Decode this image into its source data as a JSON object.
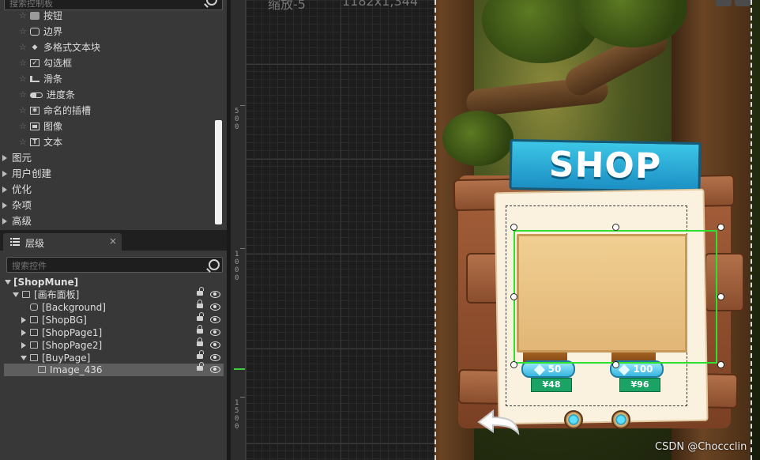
{
  "palette": {
    "search_placeholder": "搜索控制板",
    "items": [
      {
        "label": "按钮",
        "icon": "button-icon"
      },
      {
        "label": "边界",
        "icon": "border-icon"
      },
      {
        "label": "多格式文本块",
        "icon": "rich-text-icon"
      },
      {
        "label": "勾选框",
        "icon": "checkbox-icon"
      },
      {
        "label": "滑条",
        "icon": "slider-icon"
      },
      {
        "label": "进度条",
        "icon": "progress-bar-icon"
      },
      {
        "label": "命名的插槽",
        "icon": "named-slot-icon"
      },
      {
        "label": "图像",
        "icon": "image-icon"
      },
      {
        "label": "文本",
        "icon": "text-icon"
      }
    ],
    "categories": [
      "图元",
      "用户创建",
      "优化",
      "杂项",
      "高级"
    ]
  },
  "hierarchy": {
    "tab_label": "层级",
    "search_placeholder": "搜索控件",
    "rows": [
      {
        "label": "[ShopMune]"
      },
      {
        "label": "[画布面板]"
      },
      {
        "label": "[Background]"
      },
      {
        "label": "[ShopBG]"
      },
      {
        "label": "[ShopPage1]"
      },
      {
        "label": "[ShopPage2]"
      },
      {
        "label": "[BuyPage]"
      },
      {
        "label": "Image_436"
      }
    ]
  },
  "designer": {
    "zoom": "缩放-5",
    "resolution": "1182x1,344",
    "ruler_labels": [
      "5\n0\n0",
      "1\n0\n0\n0",
      "1\n5\n0\n0"
    ]
  },
  "preview": {
    "sign_text": "SHOP",
    "items": [
      {
        "gems": "50",
        "price": "¥48"
      },
      {
        "gems": "100",
        "price": "¥96"
      }
    ]
  },
  "watermark": "CSDN @Choccclin",
  "colors": {
    "selection": "#30e030",
    "sign": "#2bb0dc",
    "price_tag": "#1aa364"
  }
}
